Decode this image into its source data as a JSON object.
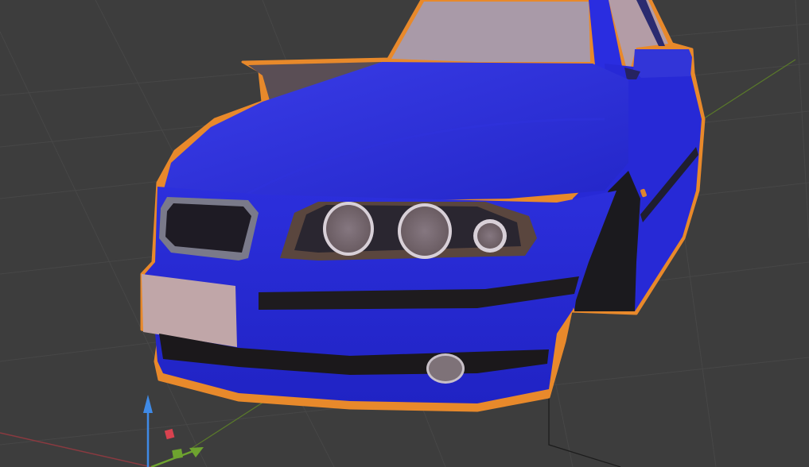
{
  "viewport": {
    "background": "#3d3d3d",
    "grid_color": "#4a4a4a",
    "selection_outline": "#e8892b"
  },
  "model": {
    "body_color": "#2a2de0",
    "body_dark": "#1a1cc0",
    "glass_color": "#a99aa8",
    "headlight_ring": "#d8d0d8",
    "headlight_lens": "#7a6c72",
    "plate_color": "#c0a6a8",
    "trim_dark": "#1e1b1e"
  },
  "gizmo": {
    "z_color": "#3f8ae6",
    "x_color": "#e34455",
    "y_color": "#6ea32f"
  }
}
